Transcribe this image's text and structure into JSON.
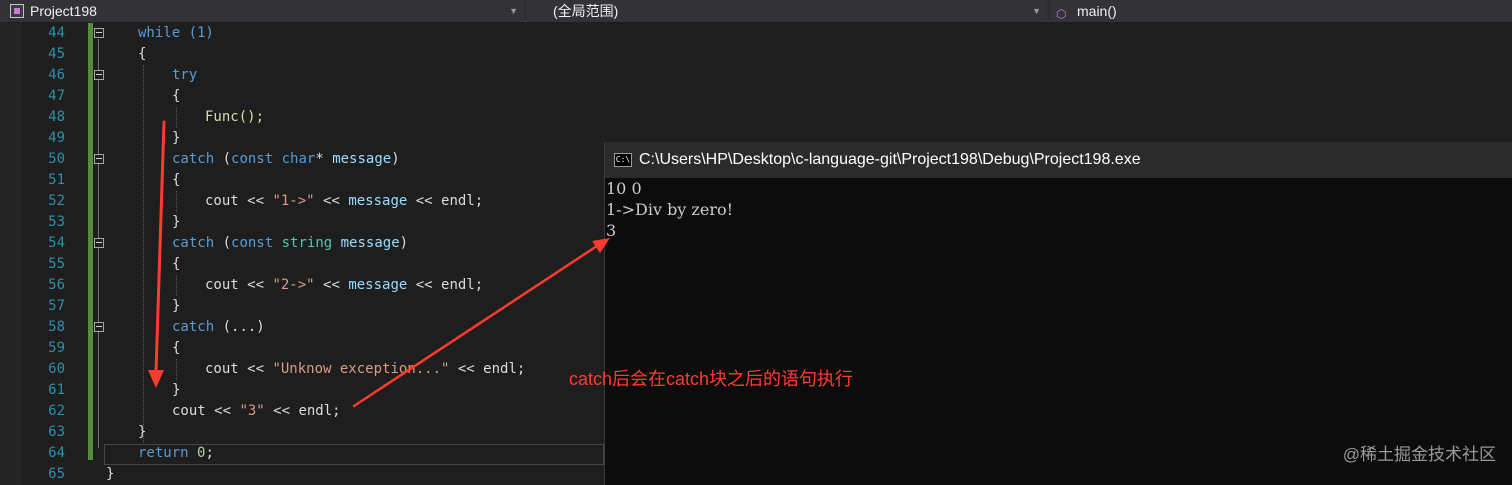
{
  "navbar": {
    "project_dropdown": "Project198",
    "scope_dropdown": "(全局范围)",
    "function_dropdown": "main()"
  },
  "editor": {
    "lines": [
      {
        "number": "44",
        "code": "while (1)"
      },
      {
        "number": "45",
        "code": "{"
      },
      {
        "number": "46",
        "code": "try"
      },
      {
        "number": "47",
        "code": "{"
      },
      {
        "number": "48",
        "code": "Func();"
      },
      {
        "number": "49",
        "code": "}"
      },
      {
        "number": "50",
        "code": "catch (const char* message)"
      },
      {
        "number": "51",
        "code": "{"
      },
      {
        "number": "52",
        "code": "cout << \"1->\" << message << endl;"
      },
      {
        "number": "53",
        "code": "}"
      },
      {
        "number": "54",
        "code": "catch (const string message)"
      },
      {
        "number": "55",
        "code": "{"
      },
      {
        "number": "56",
        "code": "cout << \"2->\" << message << endl;"
      },
      {
        "number": "57",
        "code": "}"
      },
      {
        "number": "58",
        "code": "catch (...)"
      },
      {
        "number": "59",
        "code": "{"
      },
      {
        "number": "60",
        "code": "cout << \"Unknow exception...\" << endl;"
      },
      {
        "number": "61",
        "code": "}"
      },
      {
        "number": "62",
        "code": "cout << \"3\" << endl;"
      },
      {
        "number": "63",
        "code": "}"
      },
      {
        "number": "64",
        "code": "return 0;"
      },
      {
        "number": "65",
        "code": "}"
      }
    ]
  },
  "console": {
    "title": "C:\\Users\\HP\\Desktop\\c-language-git\\Project198\\Debug\\Project198.exe",
    "output": [
      "10 0",
      "1->Div by zero!",
      "3"
    ]
  },
  "annotation": {
    "text": "catch后会在catch块之后的语句执行",
    "color": "#ff3b30"
  },
  "watermark": "@稀土掘金技术社区",
  "colors": {
    "keyword": "#569cd6",
    "type": "#4ec9b0",
    "string": "#d69d85",
    "variable": "#9cdcfe",
    "function": "#dcdcaa",
    "line_number": "#2b91af",
    "change_bar": "#5a8b3a"
  }
}
